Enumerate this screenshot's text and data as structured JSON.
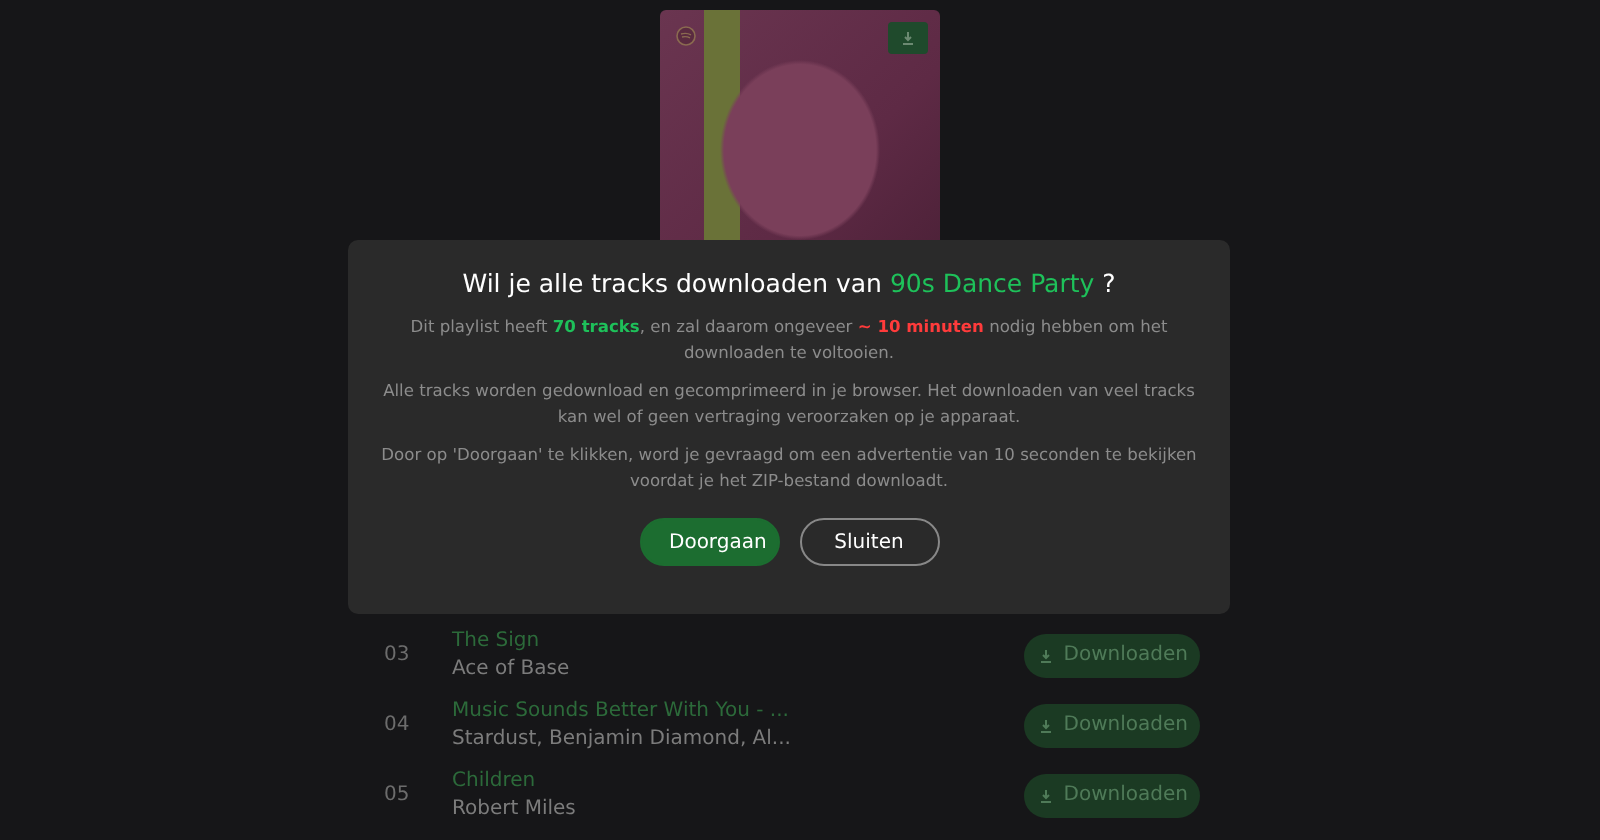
{
  "cover": {
    "download_button": true
  },
  "tracks": [
    {
      "number": "03",
      "title": "The Sign",
      "artist": "Ace of Base",
      "button": "Downloaden"
    },
    {
      "number": "04",
      "title": "Music Sounds Better With You - ...",
      "artist": "Stardust, Benjamin Diamond, Al...",
      "button": "Downloaden"
    },
    {
      "number": "05",
      "title": "Children",
      "artist": "Robert Miles",
      "button": "Downloaden"
    }
  ],
  "dialog": {
    "title": [
      {
        "text": "Wil je alle tracks downloaden van "
      },
      {
        "text": "90s Dance Party",
        "color": "#1ec15a"
      },
      {
        "text": " ?"
      }
    ],
    "paragraphs": [
      [
        {
          "text": "Dit playlist heeft "
        },
        {
          "text": "70 tracks",
          "color": "#1ec15a",
          "bold": true
        },
        {
          "text": ", en zal daarom ongeveer "
        },
        {
          "text": "~ 10 minuten",
          "color": "#ff3b3b",
          "bold": true
        },
        {
          "text": " nodig hebben om het downloaden te voltooien."
        }
      ],
      [
        {
          "text": "Alle tracks worden gedownload en gecomprimeerd in je browser. Het downloaden van veel tracks kan wel of geen vertraging veroorzaken op je apparaat."
        }
      ],
      [
        {
          "text": "Door op 'Doorgaan' te klikken, word je gevraagd om een advertentie van 10 seconden te bekijken voordat je het ZIP-bestand downloadt."
        }
      ]
    ],
    "buttons": [
      {
        "label": "Doorgaan",
        "kind": "primary"
      },
      {
        "label": "Sluiten",
        "kind": "secondary"
      }
    ]
  }
}
